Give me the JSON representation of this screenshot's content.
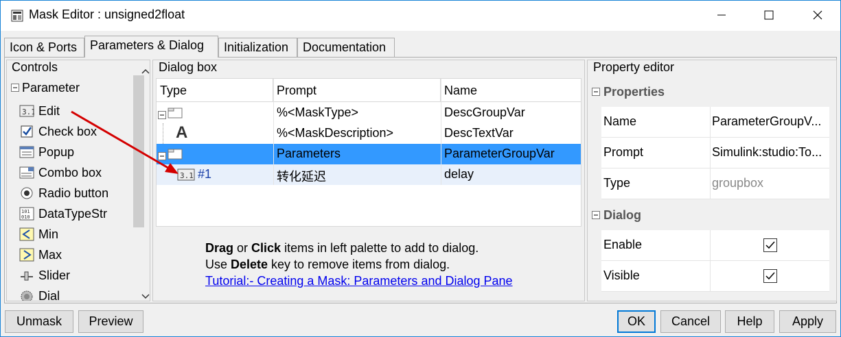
{
  "window": {
    "title": "Mask Editor : unsigned2float"
  },
  "tabs": [
    {
      "label": "Icon & Ports",
      "active": false
    },
    {
      "label": "Parameters & Dialog",
      "active": true
    },
    {
      "label": "Initialization",
      "active": false
    },
    {
      "label": "Documentation",
      "active": false
    }
  ],
  "controls": {
    "title": "Controls",
    "group": "Parameter",
    "items": [
      {
        "label": "Edit",
        "icon": "edit-icon"
      },
      {
        "label": "Check box",
        "icon": "checkbox-icon"
      },
      {
        "label": "Popup",
        "icon": "popup-icon"
      },
      {
        "label": "Combo box",
        "icon": "combobox-icon"
      },
      {
        "label": "Radio button",
        "icon": "radio-icon"
      },
      {
        "label": "DataTypeStr",
        "icon": "datatype-icon"
      },
      {
        "label": "Min",
        "icon": "min-icon"
      },
      {
        "label": "Max",
        "icon": "max-icon"
      },
      {
        "label": "Slider",
        "icon": "slider-icon"
      },
      {
        "label": "Dial",
        "icon": "dial-icon"
      }
    ]
  },
  "dialog_box": {
    "title": "Dialog box",
    "columns": [
      "Type",
      "Prompt",
      "Name"
    ],
    "rows": [
      {
        "type": "",
        "prompt": "%<MaskType>",
        "name": "DescGroupVar"
      },
      {
        "type": "",
        "prompt": "%<MaskDescription>",
        "name": "DescTextVar"
      },
      {
        "type": "",
        "prompt": "Parameters",
        "name": "ParameterGroupVar",
        "selected": true
      },
      {
        "type": "#1",
        "prompt": "转化延迟",
        "name": "delay"
      }
    ],
    "hint_line1_bold1": "Drag",
    "hint_line1_mid": " or ",
    "hint_line1_bold2": "Click",
    "hint_line1_rest": " items in left palette to add to dialog.",
    "hint_line2_pre": "Use ",
    "hint_line2_bold": "Delete",
    "hint_line2_rest": " key to remove items from dialog.",
    "tutorial_link": "Tutorial:- Creating a Mask: Parameters and Dialog Pane"
  },
  "property_editor": {
    "title": "Property editor",
    "properties_section": "Properties",
    "properties": [
      {
        "key": "Name",
        "value": "ParameterGroupV..."
      },
      {
        "key": "Prompt",
        "value": "Simulink:studio:To..."
      },
      {
        "key": "Type",
        "value": "groupbox"
      }
    ],
    "dialog_section": "Dialog",
    "dialog": [
      {
        "key": "Enable",
        "checked": true
      },
      {
        "key": "Visible",
        "checked": true
      }
    ]
  },
  "buttons": {
    "unmask": "Unmask",
    "preview": "Preview",
    "ok": "OK",
    "cancel": "Cancel",
    "help": "Help",
    "apply": "Apply"
  },
  "colors": {
    "selection": "#3399ff",
    "row_hover": "#e8f0fb",
    "accent": "#0078d7",
    "arrow": "#d40000"
  }
}
